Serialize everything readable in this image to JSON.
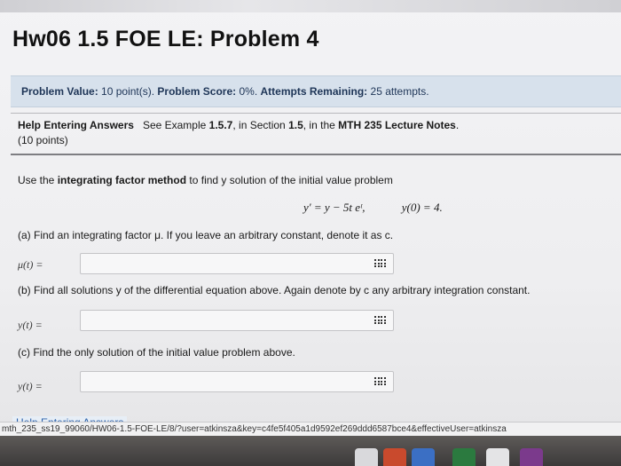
{
  "title": "Hw06 1.5 FOE LE: Problem 4",
  "info": {
    "value_label": "Problem Value:",
    "value_text": "10 point(s).",
    "score_label": "Problem Score:",
    "score_text": "0%.",
    "attempts_label": "Attempts Remaining:",
    "attempts_text": "25 attempts."
  },
  "help": {
    "link": "Help Entering Answers",
    "see": "See Example",
    "example": "1.5.7",
    "in_section": ", in Section",
    "section": "1.5",
    "in_the": ", in the",
    "notes": "MTH 235 Lecture Notes",
    "period": ".",
    "points": "(10 points)"
  },
  "problem": {
    "lead": "Use the",
    "method": "integrating factor method",
    "rest": "to find y solution of the initial value problem",
    "equation": "y′ = y − 5t eᵗ,",
    "initial": "y(0) = 4."
  },
  "parts": {
    "a": {
      "prompt": "(a) Find an integrating factor μ. If you leave an arbitrary constant, denote it as c.",
      "label": "μ(t) =",
      "value": ""
    },
    "b": {
      "prompt": "(b) Find all solutions y of the differential equation above. Again denote by c any arbitrary integration constant.",
      "label": "y(t) =",
      "value": ""
    },
    "c": {
      "prompt": "(c) Find the only solution of the initial value problem above.",
      "label": "y(t) =",
      "value": ""
    }
  },
  "footer": {
    "help_link": "Help Entering Answers",
    "status_url": "mth_235_ss19_99060/HW06-1.5-FOE-LE/8/?user=atkinsza&key=c4fe5f405a1d9592ef269ddd6587bce4&effectiveUser=atkinsza"
  },
  "icons": {
    "keyboard": "keyboard-icon"
  },
  "colors": {
    "info_bg": "#d7e1ec",
    "link": "#2a5fa8"
  }
}
